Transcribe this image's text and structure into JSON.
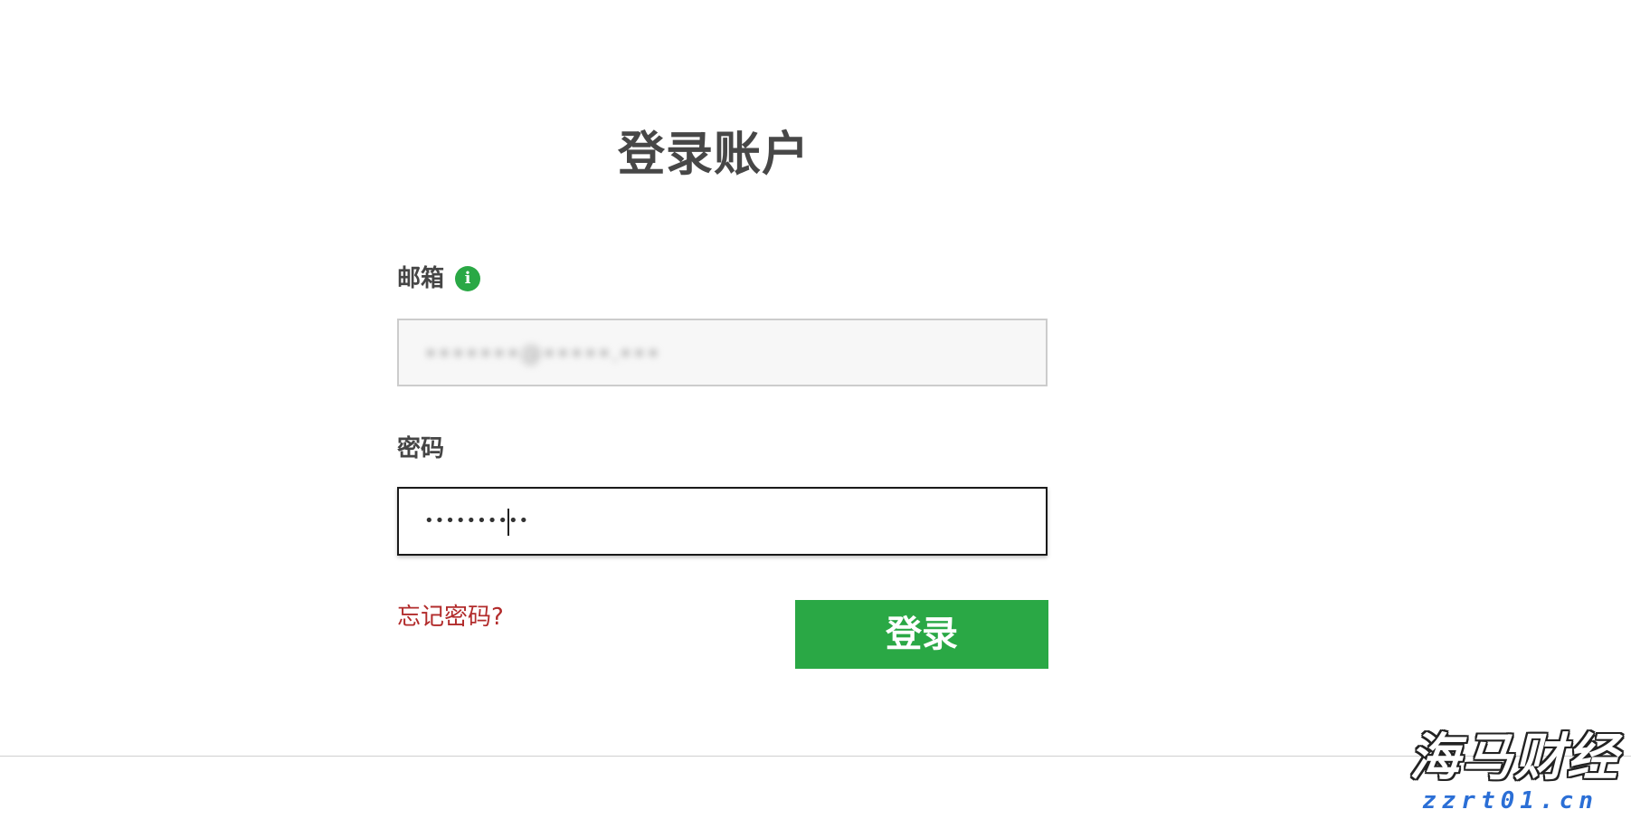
{
  "login_form": {
    "title": "登录账户",
    "email_label": "邮箱",
    "email_info_icon": "info-icon",
    "email_value": "•••••••@•••••.•••",
    "password_label": "密码",
    "password_value": "••••••••••",
    "forgot_password_link": "忘记密码?",
    "login_button": "登录"
  },
  "watermark": {
    "main": "海马财经",
    "sub": "zzrt01.cn"
  },
  "colors": {
    "accent_green": "#2aa845",
    "link_red": "#b22b2b",
    "title_gray": "#474747",
    "watermark_blue": "#2b6fd6"
  }
}
